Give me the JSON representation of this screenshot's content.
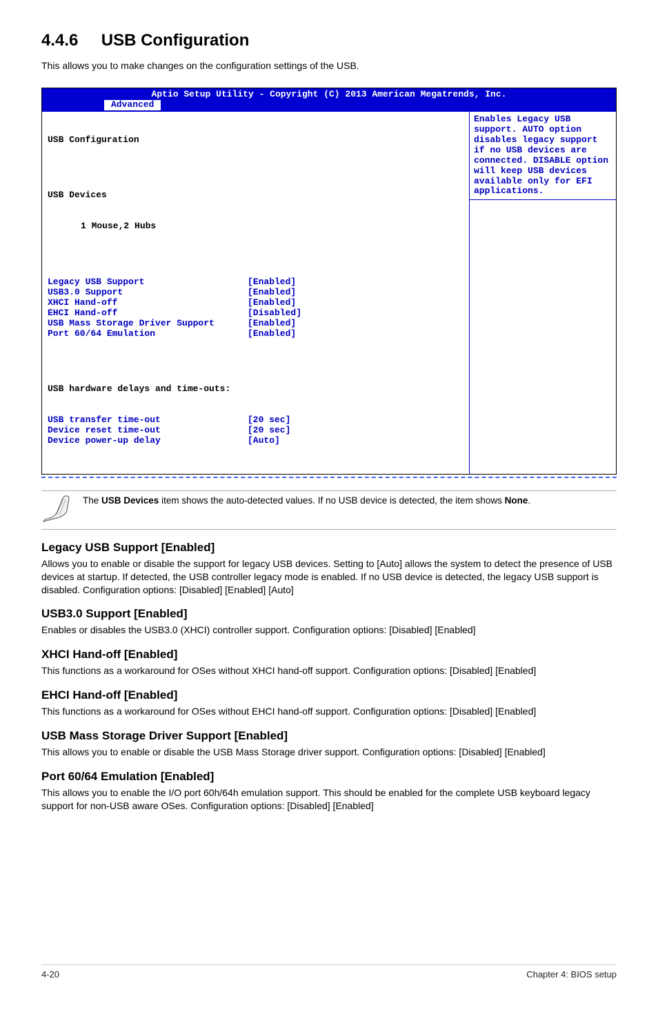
{
  "section": {
    "number": "4.4.6",
    "title": "USB Configuration",
    "intro": "This allows you to make changes on the configuration settings of the USB."
  },
  "bios": {
    "header_title": "Aptio Setup Utility - Copyright (C) 2013 American Megatrends, Inc.",
    "tab_active": "Advanced",
    "title": "USB Configuration",
    "devices_label": "USB Devices",
    "devices_value": "1 Mouse,2 Hubs",
    "rows": [
      {
        "label": "Legacy USB Support",
        "value": "[Enabled]"
      },
      {
        "label": "USB3.0 Support",
        "value": "[Enabled]"
      },
      {
        "label": "XHCI Hand-off",
        "value": "[Enabled]"
      },
      {
        "label": "EHCI Hand-off",
        "value": "[Disabled]"
      },
      {
        "label": "USB Mass Storage Driver Support",
        "value": "[Enabled]"
      },
      {
        "label": "Port 60/64 Emulation",
        "value": "[Enabled]"
      }
    ],
    "timeouts_header": "USB hardware delays and time-outs:",
    "timeout_rows": [
      {
        "label": "USB transfer time-out",
        "value": "[20 sec]"
      },
      {
        "label": "Device reset time-out",
        "value": "[20 sec]"
      },
      {
        "label": "Device power-up delay",
        "value": "[Auto]"
      }
    ],
    "help_text": "Enables Legacy USB support. AUTO option disables legacy support if no USB devices are connected. DISABLE option will keep USB devices available only for EFI applications."
  },
  "note": {
    "prefix": "The ",
    "bold1": "USB Devices",
    "middle": " item shows the auto-detected values. If no USB device is detected, the item shows ",
    "bold2": "None",
    "suffix": "."
  },
  "options": [
    {
      "title": "Legacy USB Support [Enabled]",
      "desc": "Allows you to enable or disable the support for legacy USB devices. Setting to [Auto] allows the system to detect the presence of USB devices at startup. If detected, the USB controller legacy mode is enabled. If no USB device is detected, the legacy USB support is disabled. Configuration options: [Disabled] [Enabled] [Auto]"
    },
    {
      "title": "USB3.0 Support [Enabled]",
      "desc": "Enables or disables the USB3.0 (XHCI) controller support. Configuration options: [Disabled] [Enabled]"
    },
    {
      "title": "XHCI Hand-off [Enabled]",
      "desc": "This functions as a workaround for OSes without XHCI hand-off support. Configuration options: [Disabled] [Enabled]"
    },
    {
      "title": "EHCI Hand-off [Enabled]",
      "desc": "This functions as a workaround for OSes without EHCI hand-off support. Configuration options: [Disabled] [Enabled]"
    },
    {
      "title": "USB Mass Storage Driver Support [Enabled]",
      "desc": "This allows you to enable or disable the USB Mass Storage driver support. Configuration options: [Disabled] [Enabled]"
    },
    {
      "title": "Port 60/64 Emulation [Enabled]",
      "desc": "This allows you to enable the I/O port 60h/64h emulation support. This should be enabled for the complete USB keyboard legacy support for non-USB aware OSes. Configuration options: [Disabled] [Enabled]"
    }
  ],
  "footer": {
    "page": "4-20",
    "chapter": "Chapter 4: BIOS setup"
  }
}
